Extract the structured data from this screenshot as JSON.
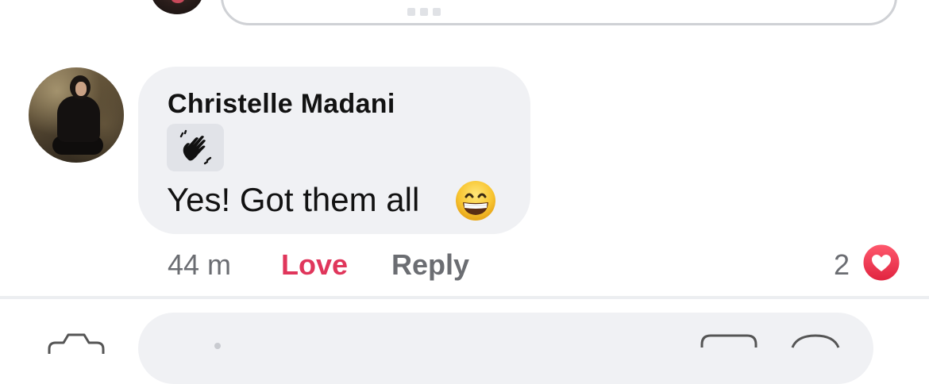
{
  "comment": {
    "author": "Christelle Madani",
    "text": "Yes! Got them all",
    "text_emoji": "grinning-face-with-smiling-eyes",
    "badge_icon": "waving-hand-icon",
    "timestamp": "44 m",
    "love_label": "Love",
    "reply_label": "Reply",
    "reaction_count": "2",
    "reaction_type": "heart-icon"
  },
  "colors": {
    "love": "#e0365b",
    "bubble": "#f0f1f4",
    "muted_text": "#6b6d72",
    "heart": "#e8334e"
  }
}
